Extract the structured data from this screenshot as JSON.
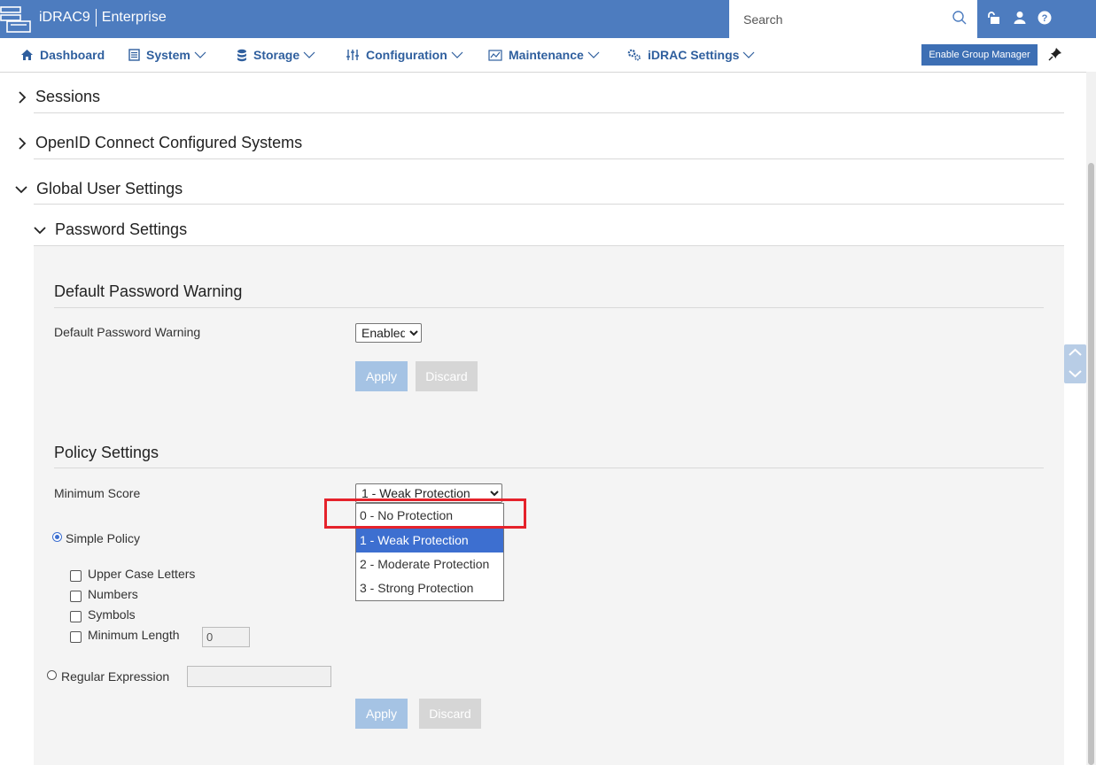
{
  "header": {
    "product": "iDRAC9",
    "edition": "Enterprise",
    "search_placeholder": "Search",
    "icons": [
      "unlock-icon",
      "user-icon",
      "help-icon"
    ]
  },
  "nav": {
    "items": [
      {
        "label": "Dashboard",
        "icon": "home-icon"
      },
      {
        "label": "System",
        "icon": "server-icon"
      },
      {
        "label": "Storage",
        "icon": "database-icon"
      },
      {
        "label": "Configuration",
        "icon": "sliders-icon"
      },
      {
        "label": "Maintenance",
        "icon": "chart-icon"
      },
      {
        "label": "iDRAC Settings",
        "icon": "gears-icon"
      }
    ],
    "group_manager_label": "Enable Group Manager"
  },
  "sections": {
    "sessions": "Sessions",
    "openid": "OpenID Connect Configured Systems",
    "global_user": "Global User Settings",
    "password_settings": "Password Settings"
  },
  "default_warning": {
    "heading": "Default Password Warning",
    "label": "Default Password Warning",
    "value": "Enabled",
    "apply": "Apply",
    "discard": "Discard"
  },
  "policy": {
    "heading": "Policy Settings",
    "min_score_label": "Minimum Score",
    "min_score_value": "1 - Weak Protection",
    "options": [
      "0 - No Protection",
      "1 - Weak Protection",
      "2 - Moderate Protection",
      "3 - Strong Protection"
    ],
    "simple_policy": "Simple Policy",
    "upper_case": "Upper Case Letters",
    "numbers": "Numbers",
    "symbols": "Symbols",
    "min_length": "Minimum Length",
    "min_length_value": "0",
    "regex": "Regular Expression",
    "apply": "Apply",
    "discard": "Discard"
  },
  "colors": {
    "header": "#4d7cbf",
    "nav_text": "#2f5f9e",
    "highlight": "#e5222b",
    "selected_option": "#3d6fd0"
  }
}
